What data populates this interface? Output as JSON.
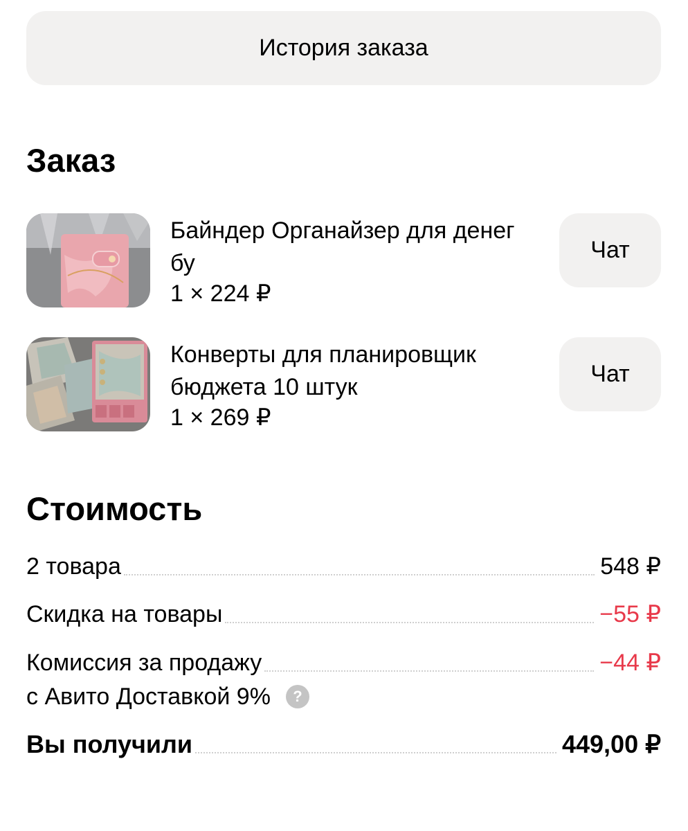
{
  "header": {
    "history_button_label": "История заказа"
  },
  "order": {
    "title": "Заказ",
    "items": [
      {
        "title": "Байндер Органайзер для денег бу",
        "price": "1 × 224 ₽",
        "chat_label": "Чат"
      },
      {
        "title": "Конверты для планировщик бюджета 10 штук",
        "price": "1 × 269 ₽",
        "chat_label": "Чат"
      }
    ]
  },
  "cost": {
    "title": "Стоимость",
    "rows": [
      {
        "label": "2 товара",
        "value": "548 ₽"
      },
      {
        "label": "Скидка на товары",
        "value": "−55 ₽"
      },
      {
        "label": "Комиссия за продажу",
        "label_line2": "с Авито Доставкой 9%",
        "value": "−44 ₽",
        "help_icon": "?"
      },
      {
        "label": "Вы получили",
        "value": "449,00 ₽"
      }
    ]
  },
  "colors": {
    "button_bg": "#f2f1f0",
    "negative": "#e8394a",
    "help_icon_bg": "#c4c4c4"
  }
}
